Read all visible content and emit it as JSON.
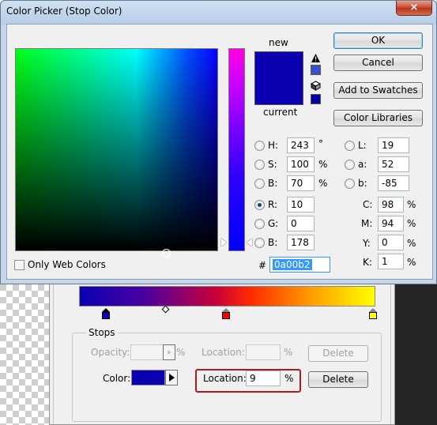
{
  "dialog": {
    "title": "Color Picker (Stop Color)",
    "close_glyph": "×",
    "new_label": "new",
    "current_label": "current",
    "new_color": "#0a00b2",
    "current_color": "#0a00b2",
    "buttons": {
      "ok": "OK",
      "cancel": "Cancel",
      "add_to_swatches": "Add to Swatches",
      "color_libraries": "Color Libraries"
    },
    "only_web_colors": "Only Web Colors",
    "hsb": [
      {
        "label": "H:",
        "value": "243",
        "unit": "°",
        "selected": false
      },
      {
        "label": "S:",
        "value": "100",
        "unit": "%",
        "selected": false
      },
      {
        "label": "B:",
        "value": "70",
        "unit": "%",
        "selected": false
      }
    ],
    "rgb": [
      {
        "label": "R:",
        "value": "10",
        "selected": true
      },
      {
        "label": "G:",
        "value": "0",
        "selected": false
      },
      {
        "label": "B:",
        "value": "178",
        "selected": false
      }
    ],
    "lab": [
      {
        "label": "L:",
        "value": "19"
      },
      {
        "label": "a:",
        "value": "52"
      },
      {
        "label": "b:",
        "value": "-85"
      }
    ],
    "cmyk": [
      {
        "label": "C:",
        "value": "98",
        "unit": "%"
      },
      {
        "label": "M:",
        "value": "94",
        "unit": "%"
      },
      {
        "label": "Y:",
        "value": "0",
        "unit": "%"
      },
      {
        "label": "K:",
        "value": "1",
        "unit": "%"
      }
    ],
    "hex_label": "#",
    "hex_value": "0a00b2",
    "warning_icon": "gamut-warning-icon",
    "cube_icon": "web-safe-cube-icon"
  },
  "gradient_editor": {
    "stops_legend": "Stops",
    "opacity_label": "Opacity:",
    "opacity_value": "",
    "opacity_unit": "%",
    "location_label_disabled": "Location:",
    "location_disabled_value": "",
    "location_disabled_unit": "%",
    "delete_disabled": "Delete",
    "color_label": "Color:",
    "color_value": "#0a00b2",
    "location_label": "Location:",
    "location_value": "9",
    "location_unit": "%",
    "delete": "Delete",
    "stop_colors": [
      "#0a00b2",
      "#ff0000",
      "#ffff00"
    ]
  }
}
